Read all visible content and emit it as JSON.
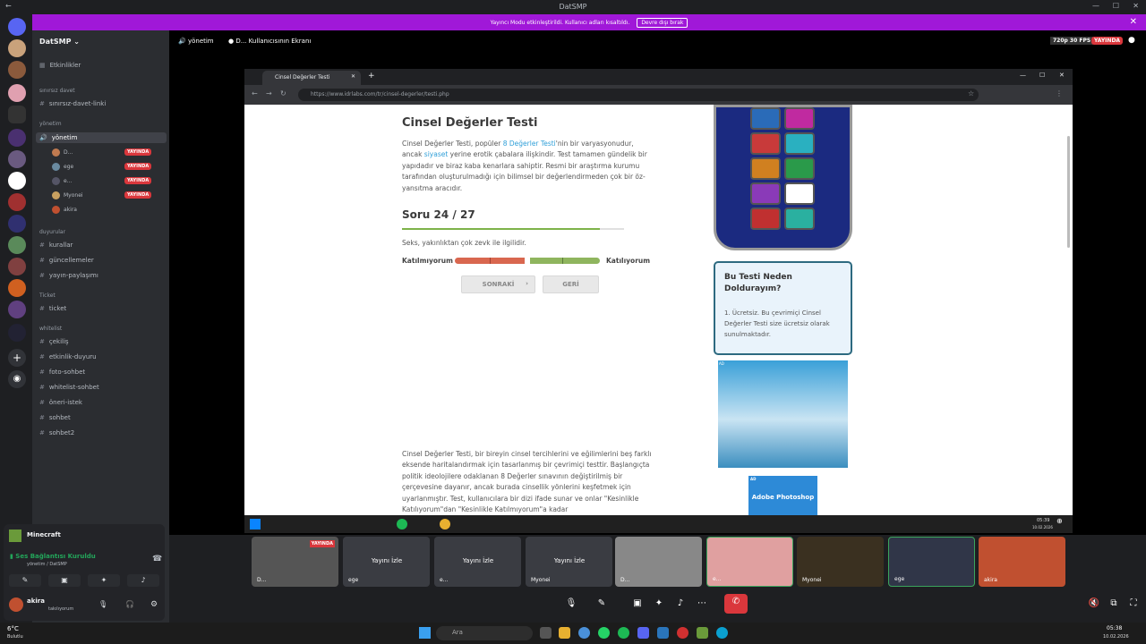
{
  "window": {
    "title": "DatSMP"
  },
  "banner": {
    "text": "Yayıncı Modu etkinleştirildi. Kullanıcı adları kısaltıldı.",
    "button": "Devre dışı bırak"
  },
  "sidebar": {
    "server_name": "DatSMP",
    "events": "Etkinlikler",
    "categories": [
      {
        "name": "sınırsız davet",
        "channels": [
          "sınırsız-davet-linki"
        ]
      },
      {
        "name": "yönetim",
        "channels": [
          "yönetim"
        ]
      },
      {
        "name": "duyurular",
        "channels": [
          "kurallar",
          "güncellemeler",
          "yayın-paylaşımı"
        ]
      },
      {
        "name": "Ticket",
        "channels": [
          "ticket"
        ]
      },
      {
        "name": "whitelist",
        "channels": [
          "çekiliş",
          "etkinlik-duyuru",
          "foto-sohbet",
          "whitelist-sohbet",
          "öneri-istek",
          "sohbet",
          "sohbet2"
        ]
      }
    ],
    "voice_users": [
      {
        "name": "D...",
        "live": "YAYINDA"
      },
      {
        "name": "ege",
        "live": "YAYINDA"
      },
      {
        "name": "e...",
        "live": "YAYINDA"
      },
      {
        "name": "Myonei",
        "live": "YAYINDA"
      },
      {
        "name": "akira",
        "live": ""
      }
    ],
    "activity": "Minecraft",
    "voice_status": "Ses Bağlantısı Kuruldu",
    "voice_sub": "yönetim / DatSMP",
    "user": {
      "name": "akira",
      "status": "takılıyorum"
    }
  },
  "top": {
    "channel": "yönetim",
    "screen": "D... Kullanıcısının Ekranı",
    "quality": "720p 30 FPS",
    "live": "YAYINDA"
  },
  "browser": {
    "tab_title": "Cinsel Değerler Testi",
    "url": "https://www.idrlabs.com/tr/cinsel-degerler/testi.php"
  },
  "page": {
    "title": "Cinsel Değerler Testi",
    "intro_1": "Cinsel Değerler Testi, popüler ",
    "intro_link": "8 Değerler Testi",
    "intro_2": "'nin bir varyasyonudur, ancak ",
    "intro_link2": "siyaset",
    "intro_3": " yerine erotik çabalara ilişkindir. Test tamamen gündelik bir yapıdadır ve biraz kaba kenarlara sahiptir. Resmi bir araştırma kurumu tarafından oluşturulmadığı için bilimsel bir değerlendirmeden çok bir öz-yansıtma aracıdır.",
    "question_counter": "Soru 24 / 27",
    "progress": 0.89,
    "question": "Seks, yakınlıktan çok zevk ile ilgilidir.",
    "label_left": "Katılmıyorum",
    "label_right": "Katılıyorum",
    "next": "SONRAKİ",
    "back": "GERİ",
    "lower_text": "Cinsel Değerler Testi, bir bireyin cinsel tercihlerini ve eğilimlerini beş farklı eksende haritalandırmak için tasarlanmış bir çevrimiçi testtir. Başlangıçta politik ideolojilere odaklanan 8 Değerler sınavının değiştirilmiş bir çerçevesine dayanır, ancak burada cinsellik yönlerini keşfetmek için uyarlanmıştır. Test, kullanıcılara bir dizi ifade sunar ve onlar \"Kesinlikle Katılıyorum\"dan \"Kesinlikle Katılmıyorum\"a kadar",
    "info_title": "Bu Testi Neden Doldurayım?",
    "info_body": "1. Ücretsiz. Bu çevrimiçi Cinsel Değerler Testi size ücretsiz olarak sunulmaktadır.",
    "ad_label": "AD",
    "ad2_text": "Adobe Photoshop"
  },
  "taskmini": {
    "time": "05:39",
    "date": "10.02.2026"
  },
  "thumbs": [
    {
      "name": "D...",
      "label": "",
      "live": "YAYINDA"
    },
    {
      "name": "ege",
      "label": "Yayını İzle",
      "live": ""
    },
    {
      "name": "e...",
      "label": "Yayını İzle",
      "live": ""
    },
    {
      "name": "Myonei",
      "label": "Yayını İzle",
      "live": ""
    },
    {
      "name": "D...",
      "label": "",
      "live": ""
    },
    {
      "name": "e...",
      "label": "",
      "live": ""
    },
    {
      "name": "Myonei",
      "label": "",
      "live": ""
    },
    {
      "name": "ege",
      "label": "",
      "live": ""
    },
    {
      "name": "akira",
      "label": "",
      "live": ""
    }
  ],
  "taskbar": {
    "weather": "6°C",
    "weather_sub": "Bulutlu",
    "search": "Ara",
    "time": "05:38",
    "date": "10.02.2026"
  },
  "colors": {
    "accent": "#a018d8",
    "live": "#da373c",
    "disagree": "#d9674f",
    "agree": "#8fb55e"
  }
}
